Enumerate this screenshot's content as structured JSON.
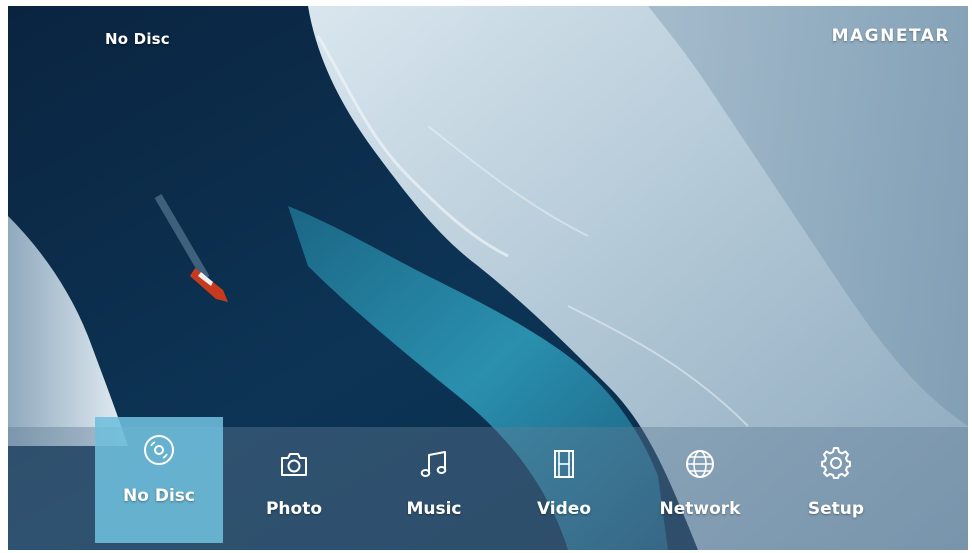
{
  "status": {
    "disc_text": "No Disc"
  },
  "brand": {
    "logo_text": "MAGNETAR"
  },
  "menu": {
    "selected_index": 0,
    "items": [
      {
        "label": "No Disc",
        "icon": "disc-icon"
      },
      {
        "label": "Photo",
        "icon": "camera-icon"
      },
      {
        "label": "Music",
        "icon": "music-note-icon"
      },
      {
        "label": "Video",
        "icon": "film-icon"
      },
      {
        "label": "Network",
        "icon": "globe-icon"
      },
      {
        "label": "Setup",
        "icon": "gear-icon"
      }
    ]
  },
  "colors": {
    "selected_tile": "#6ebedc",
    "menu_bar": "#5f7d96",
    "text": "#ffffff"
  }
}
